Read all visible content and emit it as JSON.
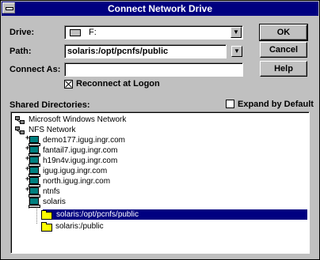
{
  "window": {
    "title": "Connect Network Drive"
  },
  "drive": {
    "label": "Drive:",
    "value": "F:"
  },
  "path": {
    "label": "Path:",
    "value": "solaris:/opt/pcnfs/public"
  },
  "connect_as": {
    "label": "Connect As:",
    "value": ""
  },
  "reconnect": {
    "label": "Reconnect at Logon",
    "checked": true
  },
  "buttons": {
    "ok": "OK",
    "cancel": "Cancel",
    "help": "Help"
  },
  "shared_directories": {
    "label": "Shared Directories:",
    "expand_label": "Expand by Default",
    "expand_checked": false,
    "tree": [
      {
        "label": "Microsoft Windows Network",
        "icon": "network-icon",
        "level": 0
      },
      {
        "label": "NFS Network",
        "icon": "network-icon",
        "level": 0
      },
      {
        "label": "demo177.igug.ingr.com",
        "icon": "computer-icon",
        "level": 1
      },
      {
        "label": "fantail7.igug.ingr.com",
        "icon": "computer-icon",
        "level": 1
      },
      {
        "label": "h19n4v.igug.ingr.com",
        "icon": "computer-icon",
        "level": 1
      },
      {
        "label": "igug.igug.ingr.com",
        "icon": "computer-icon",
        "level": 1
      },
      {
        "label": "north.igug.ingr.com",
        "icon": "computer-icon",
        "level": 1
      },
      {
        "label": "ntnfs",
        "icon": "computer-icon",
        "level": 1
      },
      {
        "label": "solaris",
        "icon": "computer-icon",
        "level": 1
      },
      {
        "label": "solaris:/opt/pcnfs/public",
        "icon": "folder-icon",
        "level": 2,
        "selected": true
      },
      {
        "label": "solaris:/public",
        "icon": "folder-icon",
        "level": 2
      }
    ]
  },
  "colors": {
    "title_bg": "#000080",
    "dialog_bg": "#c0c0c0",
    "selection": "#000080"
  }
}
